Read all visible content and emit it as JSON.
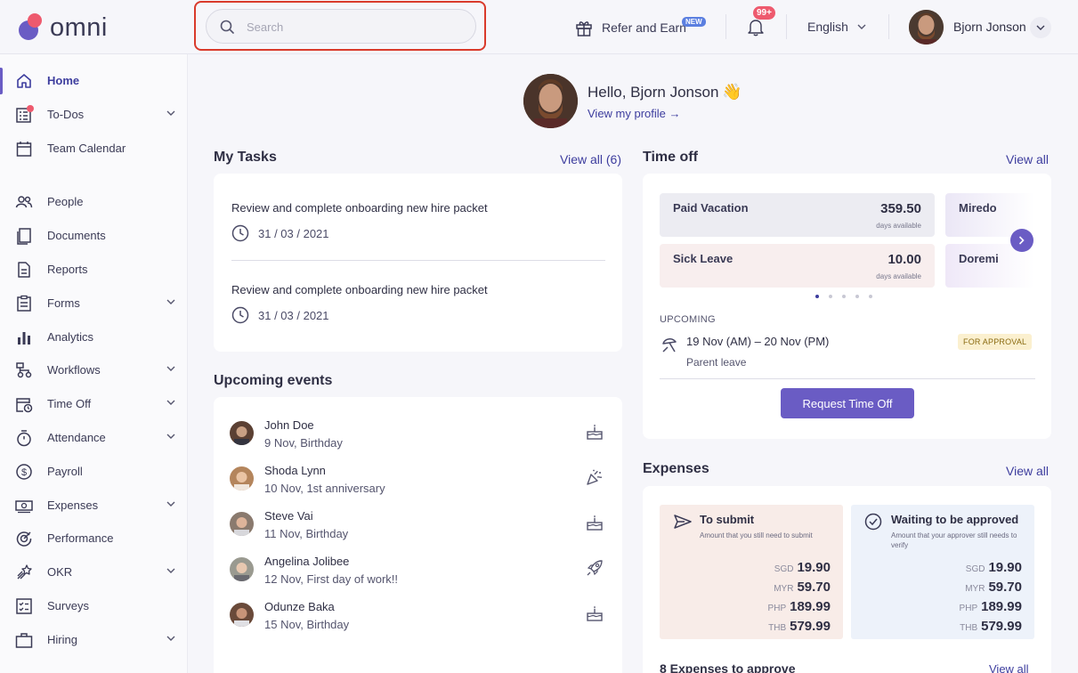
{
  "topbar": {
    "logo_text": "omni",
    "search_placeholder": "Search",
    "refer_label": "Refer and Earn",
    "refer_badge": "NEW",
    "notifications_count": "99+",
    "language": "English",
    "user_name": "Bjorn Jonson"
  },
  "sidebar": {
    "items": [
      {
        "label": "Home",
        "icon": "home-icon"
      },
      {
        "label": "To-Dos",
        "icon": "todos-icon"
      },
      {
        "label": "Team Calendar",
        "icon": "calendar-icon"
      },
      {
        "label": "People",
        "icon": "people-icon"
      },
      {
        "label": "Documents",
        "icon": "documents-icon"
      },
      {
        "label": "Reports",
        "icon": "reports-icon"
      },
      {
        "label": "Forms",
        "icon": "forms-icon"
      },
      {
        "label": "Analytics",
        "icon": "analytics-icon"
      },
      {
        "label": "Workflows",
        "icon": "workflows-icon"
      },
      {
        "label": "Time Off",
        "icon": "time-off-icon"
      },
      {
        "label": "Attendance",
        "icon": "attendance-icon"
      },
      {
        "label": "Payroll",
        "icon": "payroll-icon"
      },
      {
        "label": "Expenses",
        "icon": "expenses-icon"
      },
      {
        "label": "Performance",
        "icon": "performance-icon"
      },
      {
        "label": "OKR",
        "icon": "okr-icon"
      },
      {
        "label": "Surveys",
        "icon": "surveys-icon"
      },
      {
        "label": "Hiring",
        "icon": "hiring-icon"
      }
    ]
  },
  "greeting": {
    "hello": "Hello, Bjorn Jonson",
    "emoji": "👋",
    "view_profile": "View my profile →"
  },
  "tasks": {
    "title": "My Tasks",
    "view_all": "View all (6)",
    "items": [
      {
        "text": "Review and complete onboarding new hire packet",
        "date": "31 / 03 / 2021"
      },
      {
        "text": "Review and complete onboarding new hire packet",
        "date": "31 / 03 / 2021"
      }
    ]
  },
  "events": {
    "title": "Upcoming events",
    "items": [
      {
        "name": "John Doe",
        "detail": "9 Nov, Birthday",
        "icon": "cake-icon"
      },
      {
        "name": "Shoda Lynn",
        "detail": "10 Nov, 1st anniversary",
        "icon": "party-popper-icon"
      },
      {
        "name": "Steve Vai",
        "detail": "11 Nov, Birthday",
        "icon": "cake-icon"
      },
      {
        "name": "Angelina Jolibee",
        "detail": "12 Nov, First day of work!!",
        "icon": "rocket-icon"
      },
      {
        "name": "Odunze Baka",
        "detail": "15 Nov, Birthday",
        "icon": "cake-icon"
      }
    ]
  },
  "timeoff": {
    "title": "Time off",
    "view_all": "View all",
    "balances": [
      {
        "label": "Paid Vacation",
        "value": "359.50",
        "unit": "days available"
      },
      {
        "label": "Miredo"
      },
      {
        "label": "Sick Leave",
        "value": "10.00",
        "unit": "days available"
      },
      {
        "label": "Doremi"
      }
    ],
    "upcoming_label": "UPCOMING",
    "upcoming_range": "19 Nov (AM)  –  20 Nov (PM)",
    "upcoming_type": "Parent leave",
    "upcoming_status": "FOR APPROVAL",
    "request_button": "Request Time Off"
  },
  "expenses": {
    "title": "Expenses",
    "view_all": "View all",
    "to_submit": {
      "title": "To submit",
      "desc": "Amount that you still need to submit",
      "amounts": [
        {
          "cur": "SGD",
          "val": "19.90"
        },
        {
          "cur": "MYR",
          "val": "59.70"
        },
        {
          "cur": "PHP",
          "val": "189.99"
        },
        {
          "cur": "THB",
          "val": "579.99"
        }
      ]
    },
    "waiting": {
      "title": "Waiting to be approved",
      "desc": "Amount that your approver still needs to verify",
      "amounts": [
        {
          "cur": "SGD",
          "val": "19.90"
        },
        {
          "cur": "MYR",
          "val": "59.70"
        },
        {
          "cur": "PHP",
          "val": "189.99"
        },
        {
          "cur": "THB",
          "val": "579.99"
        }
      ]
    },
    "footer": "8 Expenses to approve",
    "footer_link": "View all"
  },
  "colors": {
    "accent": "#6a5cc4",
    "link": "#3d3d9e",
    "brand_red": "#ee5a6e",
    "highlight": "#d93a2b"
  }
}
